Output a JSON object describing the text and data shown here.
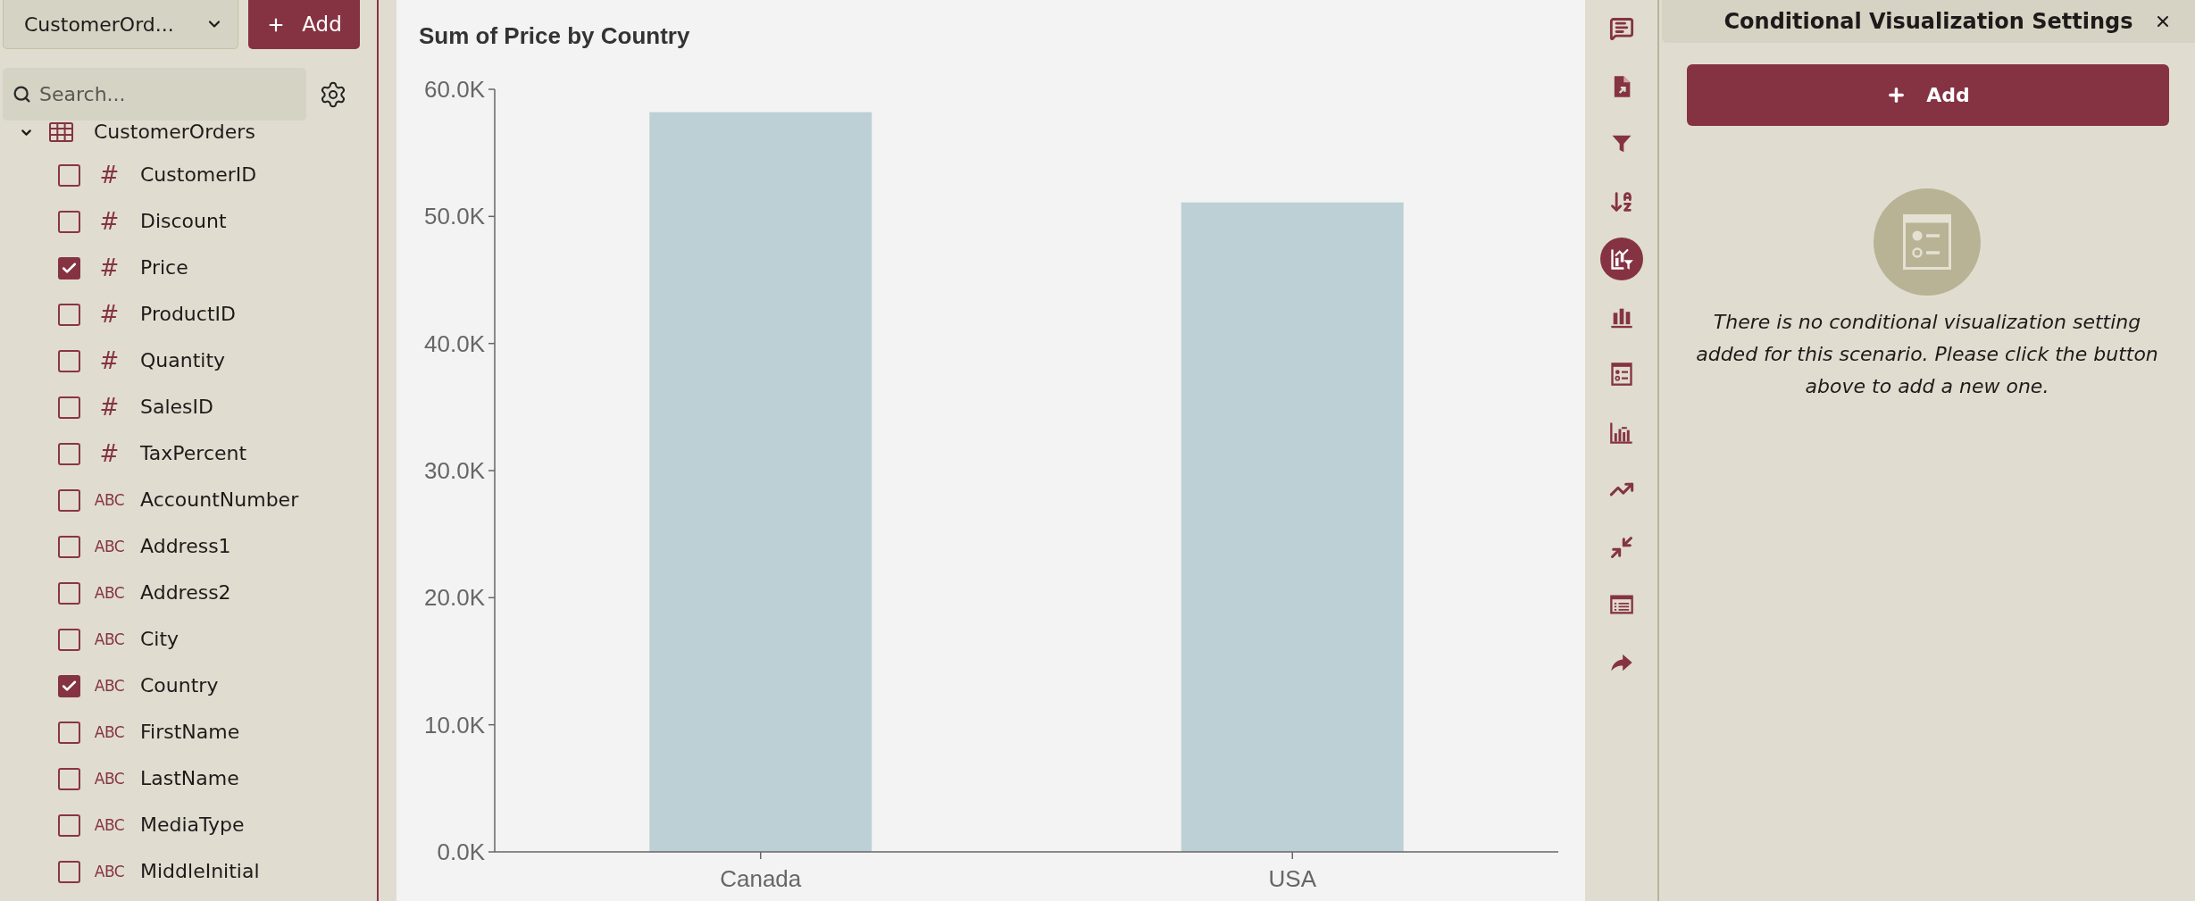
{
  "data_panel": {
    "source_select": {
      "value": "CustomerOrd..."
    },
    "add_button": {
      "label": "Add"
    },
    "search": {
      "placeholder": "Search..."
    },
    "tree": [
      {
        "label": "CustomerOrders",
        "expanded": true,
        "children": [
          {
            "kind": "number",
            "type_label": "#",
            "label": "CustomerID",
            "checked": false
          },
          {
            "kind": "number",
            "type_label": "#",
            "label": "Discount",
            "checked": false
          },
          {
            "kind": "number",
            "type_label": "#",
            "label": "Price",
            "checked": true
          },
          {
            "kind": "number",
            "type_label": "#",
            "label": "ProductID",
            "checked": false
          },
          {
            "kind": "number",
            "type_label": "#",
            "label": "Quantity",
            "checked": false
          },
          {
            "kind": "number",
            "type_label": "#",
            "label": "SalesID",
            "checked": false
          },
          {
            "kind": "number",
            "type_label": "#",
            "label": "TaxPercent",
            "checked": false
          },
          {
            "kind": "text",
            "type_label": "ABC",
            "label": "AccountNumber",
            "checked": false
          },
          {
            "kind": "text",
            "type_label": "ABC",
            "label": "Address1",
            "checked": false
          },
          {
            "kind": "text",
            "type_label": "ABC",
            "label": "Address2",
            "checked": false
          },
          {
            "kind": "text",
            "type_label": "ABC",
            "label": "City",
            "checked": false
          },
          {
            "kind": "text",
            "type_label": "ABC",
            "label": "Country",
            "checked": true
          },
          {
            "kind": "text",
            "type_label": "ABC",
            "label": "FirstName",
            "checked": false
          },
          {
            "kind": "text",
            "type_label": "ABC",
            "label": "LastName",
            "checked": false
          },
          {
            "kind": "text",
            "type_label": "ABC",
            "label": "MediaType",
            "checked": false
          },
          {
            "kind": "text",
            "type_label": "ABC",
            "label": "MiddleInitial",
            "checked": false
          }
        ]
      }
    ]
  },
  "chart": {
    "chart_data": {
      "type": "bar",
      "title": "Sum of Price by Country",
      "categories": [
        "Canada",
        "USA"
      ],
      "series": [
        {
          "color": "#bcd0d5",
          "values": [
            58200,
            51100
          ]
        }
      ],
      "ylim": [
        0,
        60000
      ],
      "yticks": [
        {
          "value": 0,
          "label": "0.0K"
        },
        {
          "value": 10000,
          "label": "10.0K"
        },
        {
          "value": 20000,
          "label": "20.0K"
        },
        {
          "value": 30000,
          "label": "30.0K"
        },
        {
          "value": 40000,
          "label": "40.0K"
        },
        {
          "value": 50000,
          "label": "50.0K"
        },
        {
          "value": 60000,
          "label": "60.0K"
        }
      ]
    }
  },
  "toolbar": {
    "items": [
      {
        "selected": false
      },
      {
        "selected": false
      },
      {
        "selected": false
      },
      {
        "selected": false
      },
      {
        "selected": true
      },
      {
        "selected": false
      },
      {
        "selected": false
      },
      {
        "selected": false
      },
      {
        "selected": false
      },
      {
        "selected": false
      },
      {
        "selected": false
      },
      {
        "selected": false
      }
    ]
  },
  "settings_panel": {
    "title": "Conditional Visualization Settings",
    "add_button": {
      "label": "Add"
    },
    "empty_message": "There is no conditional visualization setting added for this scenario. Please click the button above to add a new one."
  }
}
